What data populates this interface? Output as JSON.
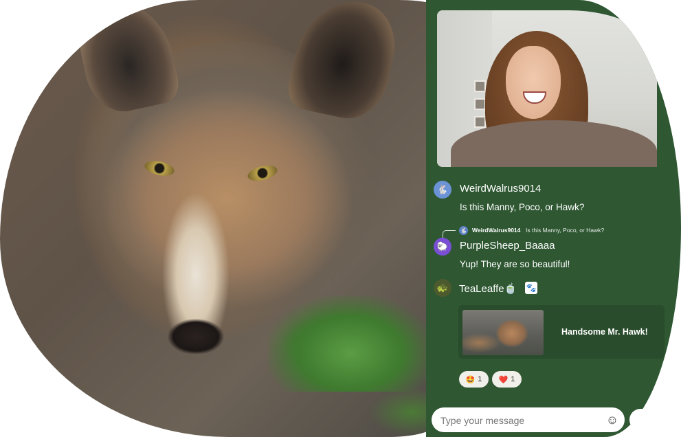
{
  "chat": {
    "messages": [
      {
        "user": "WeirdWalrus9014",
        "text": "Is this Manny, Poco, or Hawk?",
        "avatar_color": "#6b93d6",
        "avatar_icon": "rabbit-icon"
      },
      {
        "user": "PurpleSheep_Baaaa",
        "text": "Yup! They are so beautiful!",
        "avatar_color": "#7a4fd6",
        "avatar_icon": "sheep-icon",
        "reply_to": {
          "user": "WeirdWalrus9014",
          "text": "Is this Manny, Poco, or Hawk?"
        }
      },
      {
        "user": "TeaLeaffe",
        "user_emoji": "🍵",
        "avatar_color": "#4d5a2e",
        "avatar_icon": "turtle-icon",
        "badge_icon": "paw-icon",
        "card": {
          "text": "Handsome Mr. Hawk!"
        },
        "reactions": [
          {
            "emoji": "🤩",
            "count": "1"
          },
          {
            "emoji": "❤️",
            "count": "1"
          }
        ]
      }
    ],
    "input": {
      "placeholder": "Type your message"
    }
  },
  "colors": {
    "panel_bg": "#2e5732",
    "card_bg": "#294c2c"
  }
}
